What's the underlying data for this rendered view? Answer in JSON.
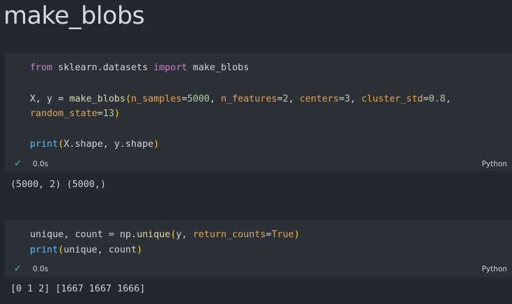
{
  "markdown": {
    "title": "make_blobs"
  },
  "cell1": {
    "line1": {
      "kw_from": "from",
      "mod": " sklearn.datasets ",
      "kw_import": "import",
      "name": " make_blobs"
    },
    "line2": {
      "a": "X, y = ",
      "fn": "make_blobs",
      "paren_open": "(",
      "p1": "n_samples",
      "eq1": "=",
      "v1": "5000",
      "sep1": ", ",
      "p2": "n_features",
      "eq2": "=",
      "v2": "2",
      "sep2": ", ",
      "p3": "centers",
      "eq3": "=",
      "v3": "3",
      "sep3": ", ",
      "p4": "cluster_std",
      "eq4": "=",
      "v4": "0.8",
      "sep4": ","
    },
    "line3": {
      "p5": "random_state",
      "eq5": "=",
      "v5": "13",
      "paren_close": ")"
    },
    "line4": {
      "fn": "print",
      "paren_open": "(",
      "args": "X.shape, y.shape",
      "paren_close": ")"
    },
    "status": {
      "check": "✓",
      "time": "0.0s",
      "lang": "Python"
    },
    "output": "(5000, 2) (5000,)"
  },
  "cell2": {
    "line1": {
      "a": "unique, count = np.",
      "fn": "unique",
      "paren_open": "(",
      "b": "y, ",
      "p1": "return_counts",
      "eq1": "=",
      "v1": "True",
      "paren_close": ")"
    },
    "line2": {
      "fn": "print",
      "paren_open": "(",
      "args": "unique, count",
      "paren_close": ")"
    },
    "status": {
      "check": "✓",
      "time": "0.0s",
      "lang": "Python"
    },
    "output": "[0 1 2] [1667 1667 1666]"
  },
  "colors": {
    "background": "#22262d",
    "cell_background": "#2b2f36",
    "keyword": "#c586c0",
    "function": "#dcdcaa",
    "param": "#e8a54b",
    "number": "#b5cea8",
    "success": "#4ec9a0"
  }
}
